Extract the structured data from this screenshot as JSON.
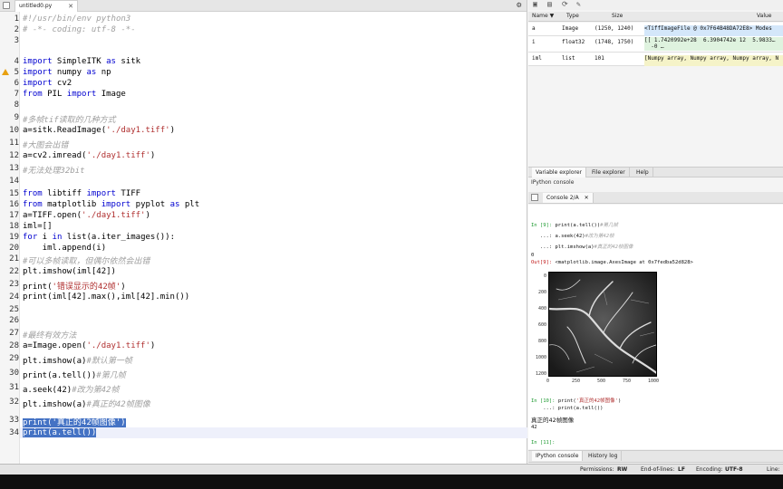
{
  "editor": {
    "tab_label": "untitled0.py",
    "tab_close": "✕",
    "gear": "⚙",
    "lines": [
      {
        "n": "1",
        "parts": [
          {
            "t": "#!/usr/bin/env python3",
            "c": "cm"
          }
        ]
      },
      {
        "n": "2",
        "parts": [
          {
            "t": "# -*- coding: utf-8 -*-",
            "c": "cm"
          }
        ]
      },
      {
        "n": "3",
        "parts": []
      },
      {
        "n": "4",
        "parts": [
          {
            "t": "import",
            "c": "kw"
          },
          {
            "t": " SimpleITK ",
            "c": ""
          },
          {
            "t": "as",
            "c": "kw"
          },
          {
            "t": " sitk",
            "c": ""
          }
        ]
      },
      {
        "n": "5",
        "parts": [
          {
            "t": "import",
            "c": "kw"
          },
          {
            "t": " numpy ",
            "c": ""
          },
          {
            "t": "as",
            "c": "kw"
          },
          {
            "t": " np",
            "c": ""
          }
        ]
      },
      {
        "n": "6",
        "parts": [
          {
            "t": "import",
            "c": "kw"
          },
          {
            "t": " cv2",
            "c": ""
          }
        ]
      },
      {
        "n": "7",
        "parts": [
          {
            "t": "from",
            "c": "kw"
          },
          {
            "t": " PIL ",
            "c": ""
          },
          {
            "t": "import",
            "c": "kw"
          },
          {
            "t": " Image",
            "c": ""
          }
        ]
      },
      {
        "n": "8",
        "parts": []
      },
      {
        "n": "9",
        "parts": [
          {
            "t": "#多帧tif读取的几种方式",
            "c": "cm"
          }
        ]
      },
      {
        "n": "10",
        "parts": [
          {
            "t": "a=sitk.ReadImage(",
            "c": ""
          },
          {
            "t": "'./day1.tiff'",
            "c": "str"
          },
          {
            "t": ")",
            "c": ""
          }
        ]
      },
      {
        "n": "11",
        "parts": [
          {
            "t": "#大图会出错",
            "c": "cm"
          }
        ]
      },
      {
        "n": "12",
        "parts": [
          {
            "t": "a=cv2.imread(",
            "c": ""
          },
          {
            "t": "'./day1.tiff'",
            "c": "str"
          },
          {
            "t": ")",
            "c": ""
          }
        ]
      },
      {
        "n": "13",
        "parts": [
          {
            "t": "#无法处理32bit",
            "c": "cm"
          }
        ]
      },
      {
        "n": "14",
        "parts": []
      },
      {
        "n": "15",
        "parts": [
          {
            "t": "from",
            "c": "kw"
          },
          {
            "t": " libtiff ",
            "c": ""
          },
          {
            "t": "import",
            "c": "kw"
          },
          {
            "t": " TIFF",
            "c": ""
          }
        ]
      },
      {
        "n": "16",
        "parts": [
          {
            "t": "from",
            "c": "kw"
          },
          {
            "t": " matplotlib ",
            "c": ""
          },
          {
            "t": "import",
            "c": "kw"
          },
          {
            "t": " pyplot ",
            "c": ""
          },
          {
            "t": "as",
            "c": "kw"
          },
          {
            "t": " plt",
            "c": ""
          }
        ]
      },
      {
        "n": "17",
        "parts": [
          {
            "t": "a=TIFF.open(",
            "c": ""
          },
          {
            "t": "'./day1.tiff'",
            "c": "str"
          },
          {
            "t": ")",
            "c": ""
          }
        ]
      },
      {
        "n": "18",
        "parts": [
          {
            "t": "iml=[]",
            "c": ""
          }
        ]
      },
      {
        "n": "19",
        "parts": [
          {
            "t": "for",
            "c": "kw"
          },
          {
            "t": " i ",
            "c": ""
          },
          {
            "t": "in",
            "c": "kw"
          },
          {
            "t": " list(a.iter_images()):",
            "c": ""
          }
        ]
      },
      {
        "n": "20",
        "parts": [
          {
            "t": "    iml.append(i)",
            "c": ""
          }
        ]
      },
      {
        "n": "21",
        "parts": [
          {
            "t": "#可以多帧读取，但偶尔依然会出错",
            "c": "cm"
          }
        ]
      },
      {
        "n": "22",
        "parts": [
          {
            "t": "plt.imshow(iml[42])",
            "c": ""
          }
        ]
      },
      {
        "n": "23",
        "parts": [
          {
            "t": "print(",
            "c": ""
          },
          {
            "t": "'错误显示的42帧'",
            "c": "str"
          },
          {
            "t": ")",
            "c": ""
          }
        ]
      },
      {
        "n": "24",
        "parts": [
          {
            "t": "print(iml[42].max(),iml[42].min())",
            "c": ""
          }
        ]
      },
      {
        "n": "25",
        "parts": []
      },
      {
        "n": "26",
        "parts": []
      },
      {
        "n": "27",
        "parts": [
          {
            "t": "#最终有效方法",
            "c": "cm"
          }
        ]
      },
      {
        "n": "28",
        "parts": [
          {
            "t": "a=Image.open(",
            "c": ""
          },
          {
            "t": "'./day1.tiff'",
            "c": "str"
          },
          {
            "t": ")",
            "c": ""
          }
        ]
      },
      {
        "n": "29",
        "parts": [
          {
            "t": "plt.imshow(a)",
            "c": ""
          },
          {
            "t": "#默认第一帧",
            "c": "cm"
          }
        ]
      },
      {
        "n": "30",
        "parts": [
          {
            "t": "print(a.tell())",
            "c": ""
          },
          {
            "t": "#第几帧",
            "c": "cm"
          }
        ]
      },
      {
        "n": "31",
        "parts": [
          {
            "t": "a.seek(42)",
            "c": ""
          },
          {
            "t": "#改为第42帧",
            "c": "cm"
          }
        ]
      },
      {
        "n": "32",
        "parts": [
          {
            "t": "plt.imshow(a)",
            "c": ""
          },
          {
            "t": "#真正的42帧图像",
            "c": "cm"
          }
        ]
      },
      {
        "n": "33",
        "parts": [
          {
            "t": "print('真正的42帧图像')",
            "c": "sel"
          }
        ]
      },
      {
        "n": "34",
        "parts": [
          {
            "t": "print(a.tell())",
            "c": "sel"
          }
        ]
      }
    ]
  },
  "variables": {
    "headers": {
      "name": "Name ▼",
      "type": "Type",
      "size": "Size",
      "value": "Value"
    },
    "rows": [
      {
        "name": "a",
        "type": "Image",
        "size": "(1250, 1240)",
        "value": "<TiffImageFile @ 0x7F64B48DA72E8> Modes"
      },
      {
        "name": "i",
        "type": "float32",
        "size": "(1748, 1750)",
        "value": "[[ 1.7420992e+28  6.3904742e 12  5.9833…\n  -0 …"
      },
      {
        "name": "iml",
        "type": "list",
        "size": "101",
        "value": "[Numpy array, Numpy array, Numpy array, N"
      }
    ]
  },
  "pane_tabs": [
    "Variable explorer",
    "File explorer",
    "Help"
  ],
  "ipython_title": "IPython console",
  "console_tab": "Console 2/A",
  "console_tab_close": "✕",
  "console": {
    "in9_prompt": "In [9]: ",
    "in9_code": "print(a.tell())",
    "in9_comment": "#第几帧",
    "cont1": "   ...: a.seek(42)",
    "cont1_comment": "#改为第42帧",
    "cont2": "   ...: plt.imshow(a)",
    "cont2_comment": "#真正的42帧图像",
    "out_value": "0",
    "out9_prompt": "Out[9]: ",
    "out9_text": "<matplotlib.image.AxesImage at 0x7fedba52d828>",
    "yticks": [
      "0",
      "200",
      "400",
      "600",
      "800",
      "1000",
      "1200"
    ],
    "xticks": [
      "0",
      "250",
      "500",
      "750",
      "1000"
    ],
    "in10_prompt": "In [10]: ",
    "in10_code": "print(",
    "in10_str": "'真正的42帧图像'",
    "in10_close": ")",
    "cont3": "    ...: print(a.tell())",
    "result1": "真正的42帧图像",
    "result2": "42",
    "in11_prompt": "In [11]:"
  },
  "bottom_tabs": [
    "IPython console",
    "History log"
  ],
  "status": {
    "perm_label": "Permissions:",
    "perm_value": "RW",
    "eol_label": "End-of-lines:",
    "eol_value": "LF",
    "enc_label": "Encoding:",
    "enc_value": "UTF-8",
    "line_label": "Line:"
  }
}
